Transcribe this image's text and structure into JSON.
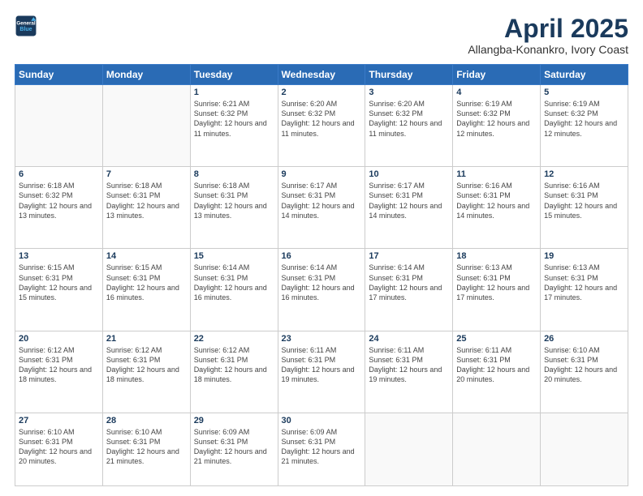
{
  "header": {
    "logo_line1": "General",
    "logo_line2": "Blue",
    "title": "April 2025",
    "location": "Allangba-Konankro, Ivory Coast"
  },
  "days_of_week": [
    "Sunday",
    "Monday",
    "Tuesday",
    "Wednesday",
    "Thursday",
    "Friday",
    "Saturday"
  ],
  "weeks": [
    [
      {
        "day": "",
        "info": ""
      },
      {
        "day": "",
        "info": ""
      },
      {
        "day": "1",
        "info": "Sunrise: 6:21 AM\nSunset: 6:32 PM\nDaylight: 12 hours and 11 minutes."
      },
      {
        "day": "2",
        "info": "Sunrise: 6:20 AM\nSunset: 6:32 PM\nDaylight: 12 hours and 11 minutes."
      },
      {
        "day": "3",
        "info": "Sunrise: 6:20 AM\nSunset: 6:32 PM\nDaylight: 12 hours and 11 minutes."
      },
      {
        "day": "4",
        "info": "Sunrise: 6:19 AM\nSunset: 6:32 PM\nDaylight: 12 hours and 12 minutes."
      },
      {
        "day": "5",
        "info": "Sunrise: 6:19 AM\nSunset: 6:32 PM\nDaylight: 12 hours and 12 minutes."
      }
    ],
    [
      {
        "day": "6",
        "info": "Sunrise: 6:18 AM\nSunset: 6:32 PM\nDaylight: 12 hours and 13 minutes."
      },
      {
        "day": "7",
        "info": "Sunrise: 6:18 AM\nSunset: 6:31 PM\nDaylight: 12 hours and 13 minutes."
      },
      {
        "day": "8",
        "info": "Sunrise: 6:18 AM\nSunset: 6:31 PM\nDaylight: 12 hours and 13 minutes."
      },
      {
        "day": "9",
        "info": "Sunrise: 6:17 AM\nSunset: 6:31 PM\nDaylight: 12 hours and 14 minutes."
      },
      {
        "day": "10",
        "info": "Sunrise: 6:17 AM\nSunset: 6:31 PM\nDaylight: 12 hours and 14 minutes."
      },
      {
        "day": "11",
        "info": "Sunrise: 6:16 AM\nSunset: 6:31 PM\nDaylight: 12 hours and 14 minutes."
      },
      {
        "day": "12",
        "info": "Sunrise: 6:16 AM\nSunset: 6:31 PM\nDaylight: 12 hours and 15 minutes."
      }
    ],
    [
      {
        "day": "13",
        "info": "Sunrise: 6:15 AM\nSunset: 6:31 PM\nDaylight: 12 hours and 15 minutes."
      },
      {
        "day": "14",
        "info": "Sunrise: 6:15 AM\nSunset: 6:31 PM\nDaylight: 12 hours and 16 minutes."
      },
      {
        "day": "15",
        "info": "Sunrise: 6:14 AM\nSunset: 6:31 PM\nDaylight: 12 hours and 16 minutes."
      },
      {
        "day": "16",
        "info": "Sunrise: 6:14 AM\nSunset: 6:31 PM\nDaylight: 12 hours and 16 minutes."
      },
      {
        "day": "17",
        "info": "Sunrise: 6:14 AM\nSunset: 6:31 PM\nDaylight: 12 hours and 17 minutes."
      },
      {
        "day": "18",
        "info": "Sunrise: 6:13 AM\nSunset: 6:31 PM\nDaylight: 12 hours and 17 minutes."
      },
      {
        "day": "19",
        "info": "Sunrise: 6:13 AM\nSunset: 6:31 PM\nDaylight: 12 hours and 17 minutes."
      }
    ],
    [
      {
        "day": "20",
        "info": "Sunrise: 6:12 AM\nSunset: 6:31 PM\nDaylight: 12 hours and 18 minutes."
      },
      {
        "day": "21",
        "info": "Sunrise: 6:12 AM\nSunset: 6:31 PM\nDaylight: 12 hours and 18 minutes."
      },
      {
        "day": "22",
        "info": "Sunrise: 6:12 AM\nSunset: 6:31 PM\nDaylight: 12 hours and 18 minutes."
      },
      {
        "day": "23",
        "info": "Sunrise: 6:11 AM\nSunset: 6:31 PM\nDaylight: 12 hours and 19 minutes."
      },
      {
        "day": "24",
        "info": "Sunrise: 6:11 AM\nSunset: 6:31 PM\nDaylight: 12 hours and 19 minutes."
      },
      {
        "day": "25",
        "info": "Sunrise: 6:11 AM\nSunset: 6:31 PM\nDaylight: 12 hours and 20 minutes."
      },
      {
        "day": "26",
        "info": "Sunrise: 6:10 AM\nSunset: 6:31 PM\nDaylight: 12 hours and 20 minutes."
      }
    ],
    [
      {
        "day": "27",
        "info": "Sunrise: 6:10 AM\nSunset: 6:31 PM\nDaylight: 12 hours and 20 minutes."
      },
      {
        "day": "28",
        "info": "Sunrise: 6:10 AM\nSunset: 6:31 PM\nDaylight: 12 hours and 21 minutes."
      },
      {
        "day": "29",
        "info": "Sunrise: 6:09 AM\nSunset: 6:31 PM\nDaylight: 12 hours and 21 minutes."
      },
      {
        "day": "30",
        "info": "Sunrise: 6:09 AM\nSunset: 6:31 PM\nDaylight: 12 hours and 21 minutes."
      },
      {
        "day": "",
        "info": ""
      },
      {
        "day": "",
        "info": ""
      },
      {
        "day": "",
        "info": ""
      }
    ]
  ]
}
